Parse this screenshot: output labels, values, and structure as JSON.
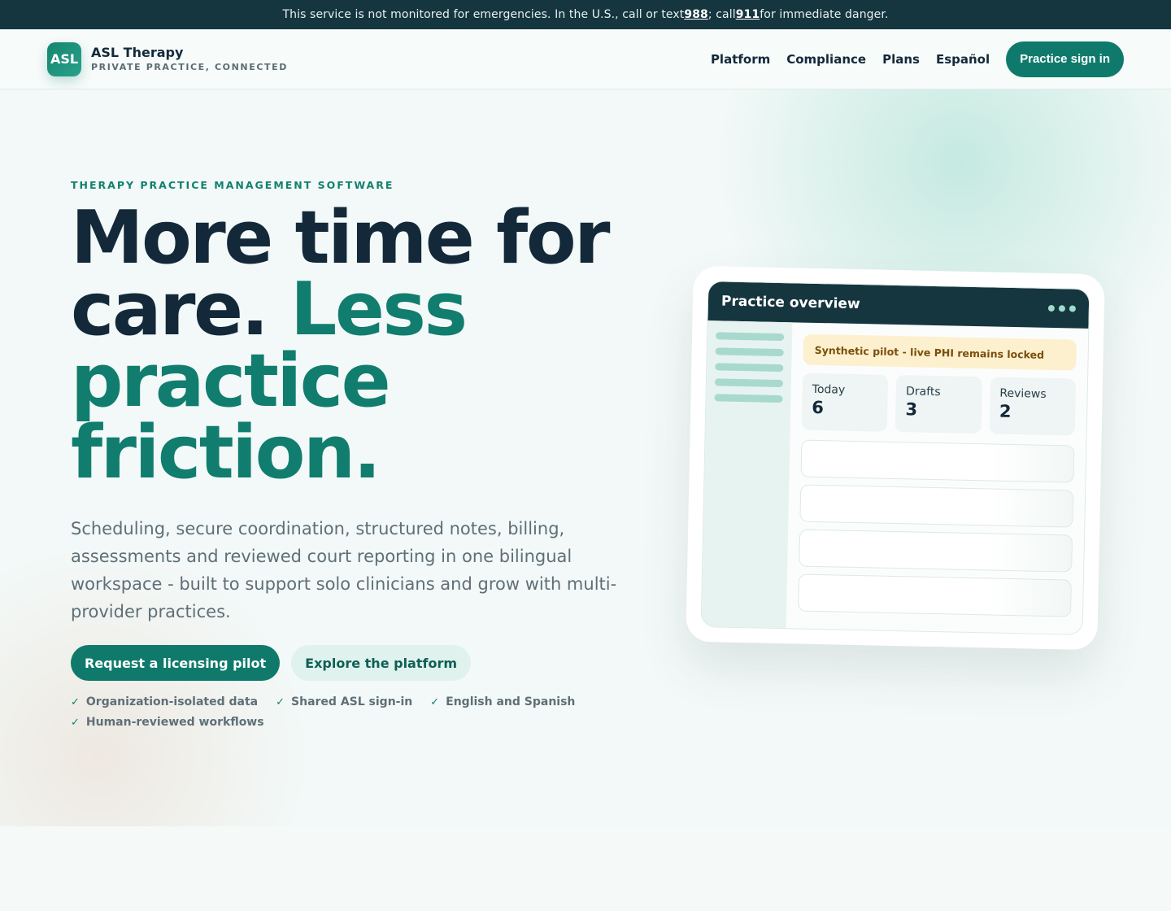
{
  "alert": {
    "text_before": "This service is not monitored for emergencies. In the U.S., call or text ",
    "number_988": "988",
    "text_middle": "; call ",
    "number_911": "911",
    "text_after": " for immediate danger."
  },
  "header": {
    "logo_text": "ASL",
    "brand_name": "ASL Therapy",
    "brand_tagline": "PRIVATE PRACTICE, CONNECTED",
    "nav": [
      "Platform",
      "Compliance",
      "Plans",
      "Español"
    ],
    "signin_label": "Practice sign in"
  },
  "hero": {
    "eyebrow": "THERAPY PRACTICE MANAGEMENT SOFTWARE",
    "headline_line1": "More time for",
    "headline_line2a": "care. ",
    "headline_line2b": "Less",
    "headline_line3": "practice",
    "headline_line4": "friction.",
    "lede": "Scheduling, secure coordination, structured notes, billing, assessments and reviewed court reporting in one bilingual workspace - built to support solo clinicians and grow with multi-provider practices.",
    "primary_cta": "Request a licensing pilot",
    "secondary_cta": "Explore the platform",
    "checks": [
      "Organization-isolated data",
      "Shared ASL sign-in",
      "English and Spanish",
      "Human-reviewed workflows"
    ],
    "check_glyph": "✓"
  },
  "mock": {
    "title": "Practice overview",
    "banner": "Synthetic pilot - live PHI remains locked",
    "stats": [
      {
        "label": "Today",
        "value": "6"
      },
      {
        "label": "Drafts",
        "value": "3"
      },
      {
        "label": "Reviews",
        "value": "2"
      }
    ]
  },
  "colors": {
    "accent": "#0f7a6c",
    "dark": "#13293a",
    "alert_bg": "#15353f",
    "banner_bg": "#fdf0cf"
  }
}
